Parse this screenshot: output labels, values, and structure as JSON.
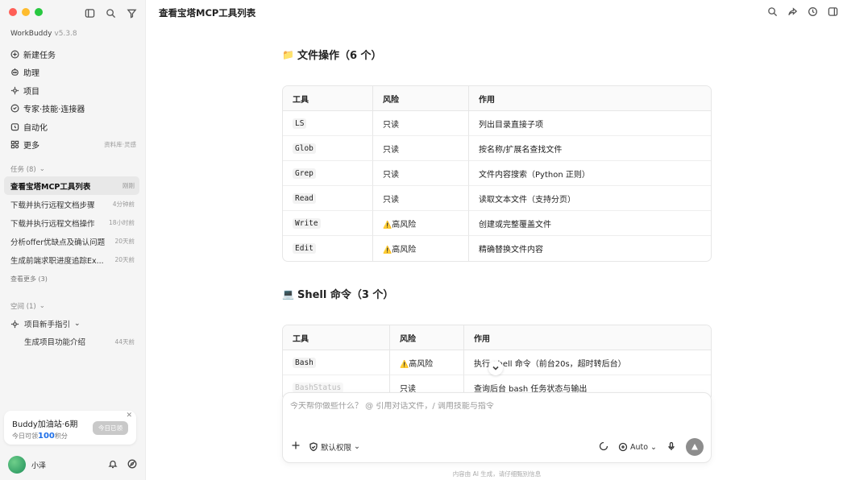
{
  "sidebar": {
    "app_name": "WorkBuddy",
    "app_version": "v5.3.8",
    "nav": [
      {
        "label": "新建任务",
        "icon": "plus-circle-icon"
      },
      {
        "label": "助理",
        "icon": "robot-icon"
      },
      {
        "label": "项目",
        "icon": "project-icon"
      },
      {
        "label": "专家·技能·连接器",
        "icon": "expert-icon"
      },
      {
        "label": "自动化",
        "icon": "clock-icon"
      },
      {
        "label": "更多",
        "icon": "grid-icon",
        "right": "资料库·灵感"
      }
    ],
    "tasks_header": "任务 (8)",
    "tasks": [
      {
        "label": "查看宝塔MCP工具列表",
        "time": "刚刚"
      },
      {
        "label": "下载并执行远程文档步骤",
        "time": "4分钟前"
      },
      {
        "label": "下载并执行远程文档操作",
        "time": "18小时前"
      },
      {
        "label": "分析offer优缺点及确认问题",
        "time": "20天前"
      },
      {
        "label": "生成前端求职进度追踪Ex...",
        "time": "20天前"
      }
    ],
    "more_tasks": "查看更多 (3)",
    "space_header": "空间 (1)",
    "space_item": "项目新手指引",
    "space_sub_item": {
      "label": "生成项目功能介绍",
      "time": "44天前"
    },
    "promo": {
      "title": "Buddy加油站·6期",
      "sub_prefix": "今日可领",
      "points": "100",
      "sub_suffix": "积分",
      "button": "今日已领"
    },
    "user": {
      "name": "小泽"
    }
  },
  "header": {
    "title": "查看宝塔MCP工具列表"
  },
  "sections": [
    {
      "emoji": "📁",
      "title": "文件操作（6 个）",
      "columns": [
        "工具",
        "风险",
        "作用"
      ],
      "rows": [
        {
          "tool": "LS",
          "risk": "只读",
          "desc": "列出目录直接子项"
        },
        {
          "tool": "Glob",
          "risk": "只读",
          "desc": "按名称/扩展名查找文件"
        },
        {
          "tool": "Grep",
          "risk": "只读",
          "desc": "文件内容搜索（Python 正则）"
        },
        {
          "tool": "Read",
          "risk": "只读",
          "desc": "读取文本文件（支持分页）"
        },
        {
          "tool": "Write",
          "risk": "高风险",
          "warn": "⚠️",
          "desc": "创建或完整覆盖文件"
        },
        {
          "tool": "Edit",
          "risk": "高风险",
          "warn": "⚠️",
          "desc": "精确替换文件内容"
        }
      ]
    },
    {
      "emoji": "💻",
      "title": "Shell 命令（3 个）",
      "columns": [
        "工具",
        "风险",
        "作用"
      ],
      "rows": [
        {
          "tool": "Bash",
          "risk": "高风险",
          "warn": "⚠️",
          "desc": "执行 Shell 命令（前台20s，超时转后台）"
        },
        {
          "tool": "BashStatus",
          "risk": "只读",
          "desc": "查询后台 bash 任务状态与输出"
        }
      ]
    }
  ],
  "composer": {
    "placeholder": "今天帮你做些什么？ @ 引用对话文件，/ 调用技能与指令",
    "permission": "默认权限",
    "model": "Auto"
  },
  "footer_note": "内容由 AI 生成，请仔细甄别信息",
  "colors": {
    "accent": "#1e6fe8",
    "warning": "#d79b00",
    "close": "#ff5f57",
    "minimize": "#febc2e",
    "zoom": "#28c840"
  }
}
